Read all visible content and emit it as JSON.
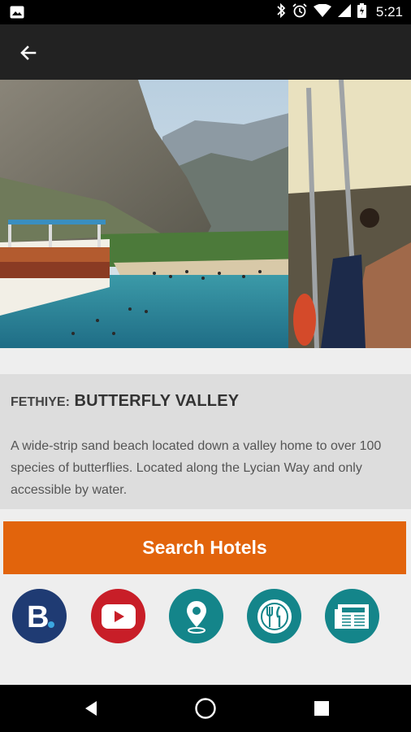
{
  "status_bar": {
    "time": "5:21",
    "icons": [
      "image-icon",
      "bluetooth-icon",
      "alarm-icon",
      "wifi-icon",
      "signal-icon",
      "battery-icon"
    ]
  },
  "toolbar": {
    "back_icon": "arrow-left-icon"
  },
  "hero": {
    "description": "photo-of-butterfly-valley-beach-with-boats"
  },
  "place": {
    "prefix": "FETHIYE:",
    "name": "BUTTERFLY VALLEY",
    "description": "A wide-strip sand beach located down a valley home to over 100 species of butterflies. Located along the Lycian Way and only accessible by water."
  },
  "actions": {
    "search_hotels_label": "Search Hotels",
    "accent_color": "#e2640c"
  },
  "icon_links": [
    {
      "icon": "booking-icon",
      "color": "#1f3b73"
    },
    {
      "icon": "youtube-icon",
      "color": "#c81e28"
    },
    {
      "icon": "map-pin-icon",
      "color": "#14858a"
    },
    {
      "icon": "restaurant-icon",
      "color": "#14858a"
    },
    {
      "icon": "newspaper-icon",
      "color": "#14858a"
    }
  ],
  "nav_bar": {
    "icons": [
      "back-triangle-icon",
      "home-circle-icon",
      "recents-square-icon"
    ]
  }
}
